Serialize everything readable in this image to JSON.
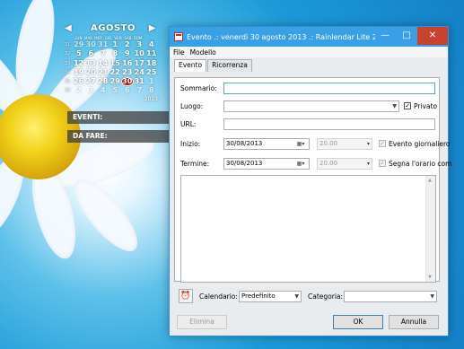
{
  "calendar": {
    "month": "AGOSTO",
    "prev_arrow": "◀",
    "next_arrow": "▶",
    "weekdays": [
      "LUN",
      "MAR",
      "MER",
      "GIO",
      "VEN",
      "SAB",
      "DOM"
    ],
    "weeks": [
      {
        "wk": "31",
        "days": [
          "29",
          "30",
          "31",
          "1",
          "2",
          "3",
          "4"
        ]
      },
      {
        "wk": "32",
        "days": [
          "5",
          "6",
          "7",
          "8",
          "9",
          "10",
          "11"
        ]
      },
      {
        "wk": "33",
        "days": [
          "12",
          "13",
          "14",
          "15",
          "16",
          "17",
          "18"
        ]
      },
      {
        "wk": "34",
        "days": [
          "19",
          "20",
          "21",
          "22",
          "23",
          "24",
          "25"
        ]
      },
      {
        "wk": "35",
        "days": [
          "26",
          "27",
          "28",
          "29",
          "30",
          "31",
          "1"
        ]
      },
      {
        "wk": "36",
        "days": [
          "2",
          "3",
          "4",
          "5",
          "6",
          "7",
          "8"
        ]
      }
    ],
    "today": "30",
    "year": "2013",
    "events_label": "EVENTI:",
    "todo_label": "DA FARE:"
  },
  "window": {
    "title": "Evento .: venerdì 30 agosto 2013 .: Rainlendar Lite 2...",
    "minimize": "—",
    "maximize": "□",
    "close": "✕"
  },
  "menu": {
    "file": "File",
    "modello": "Modello"
  },
  "tabs": {
    "evento": "Evento",
    "ricorrenza": "Ricorrenza"
  },
  "form": {
    "sommario_label": "Sommario:",
    "sommario_value": "",
    "luogo_label": "Luogo:",
    "luogo_value": "",
    "privato_label": "Privato",
    "privato_checked": true,
    "url_label": "URL:",
    "url_value": "",
    "inizio_label": "Inizio:",
    "inizio_date": "30/08/2013",
    "inizio_time": "20.00",
    "evento_giornaliero_label": "Evento giornaliero",
    "termine_label": "Termine:",
    "termine_date": "30/08/2013",
    "termine_time": "20.00",
    "segna_orario_label": "Segna l'orario com",
    "notes_value": ""
  },
  "bottom": {
    "calendario_label": "Calendario:",
    "calendario_value": "Predefinito",
    "categoria_label": "Categoria:",
    "categoria_value": "",
    "elimina": "Elimina",
    "ok": "OK",
    "annulla": "Annulla"
  },
  "colors": {
    "titlebar": "#3aa0e6",
    "close_button": "#c9412f",
    "today_highlight": "#c81c1c"
  }
}
